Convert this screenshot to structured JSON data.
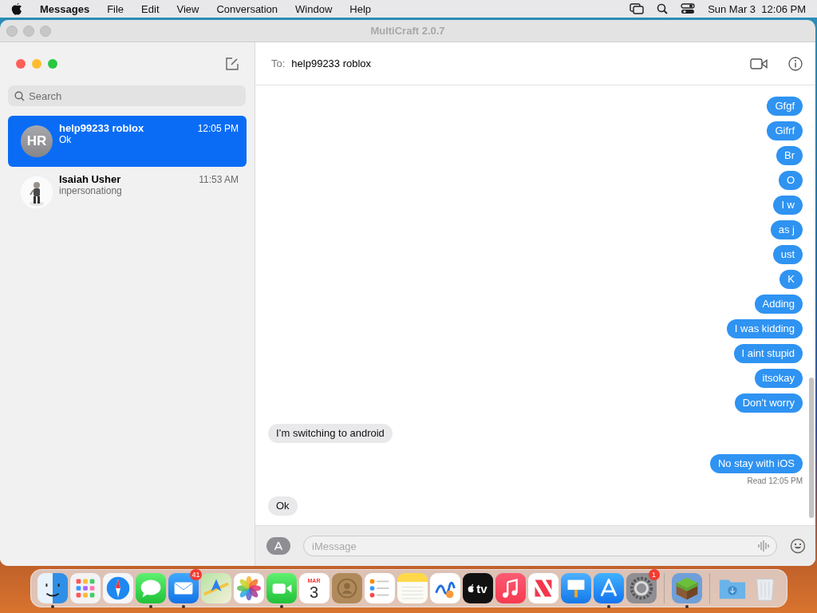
{
  "menu_bar": {
    "app": "Messages",
    "items": [
      "File",
      "Edit",
      "View",
      "Conversation",
      "Window",
      "Help"
    ],
    "date": "Sun Mar 3",
    "time": "12:06 PM"
  },
  "background_window": {
    "title": "MultiCraft 2.0.7"
  },
  "sidebar": {
    "search": {
      "placeholder": "Search"
    },
    "conversations": [
      {
        "name": "help99233 roblox",
        "preview": "Ok",
        "time": "12:05 PM",
        "avatar": {
          "kind": "initials",
          "text": "HR"
        },
        "selected": true
      },
      {
        "name": "Isaiah Usher",
        "preview": "inpersonationg",
        "time": "11:53 AM",
        "selected": false
      }
    ]
  },
  "conversation": {
    "to_label": "To:",
    "recipient": "help99233 roblox",
    "messages": [
      {
        "kind": "outgoing",
        "text": "Gfgf"
      },
      {
        "kind": "outgoing",
        "text": "Gifrf"
      },
      {
        "kind": "outgoing",
        "text": "Br"
      },
      {
        "kind": "outgoing",
        "text": "O"
      },
      {
        "kind": "outgoing",
        "text": "I w"
      },
      {
        "kind": "outgoing",
        "text": "as j"
      },
      {
        "kind": "outgoing",
        "text": "ust"
      },
      {
        "kind": "outgoing",
        "text": "K"
      },
      {
        "kind": "outgoing",
        "text": "Adding"
      },
      {
        "kind": "outgoing",
        "text": "I was kidding"
      },
      {
        "kind": "outgoing",
        "text": "I aint stupid"
      },
      {
        "kind": "outgoing",
        "text": "itsokay"
      },
      {
        "kind": "outgoing",
        "text": "Don't worry"
      },
      {
        "kind": "incoming",
        "text": "I’m switching to android"
      },
      {
        "kind": "outgoing",
        "text": "No stay with iOS",
        "receipt": "Read 12:05 PM"
      },
      {
        "kind": "incoming",
        "text": "Ok"
      }
    ],
    "composer": {
      "placeholder": "iMessage"
    }
  },
  "dock": [
    {
      "kind": "finder",
      "running": true
    },
    {
      "kind": "launchpad",
      "running": false
    },
    {
      "kind": "safari",
      "running": false
    },
    {
      "kind": "messages",
      "running": true
    },
    {
      "kind": "mail",
      "running": true,
      "badge": "41"
    },
    {
      "kind": "maps",
      "running": false
    },
    {
      "kind": "photos",
      "running": false
    },
    {
      "kind": "facetime",
      "running": true
    },
    {
      "kind": "calendar",
      "running": false,
      "month": "MAR",
      "day": "3"
    },
    {
      "kind": "contacts",
      "running": false
    },
    {
      "kind": "reminders",
      "running": false
    },
    {
      "kind": "notes",
      "running": false
    },
    {
      "kind": "freeform",
      "running": false
    },
    {
      "kind": "tv",
      "running": false,
      "label": "tv"
    },
    {
      "kind": "music",
      "running": false
    },
    {
      "kind": "news",
      "running": false
    },
    {
      "kind": "keynote",
      "running": false
    },
    {
      "kind": "appstore",
      "running": true
    },
    {
      "kind": "settings",
      "running": false,
      "badge": "1"
    },
    {
      "kind": "separator"
    },
    {
      "kind": "minecraft",
      "running": true
    },
    {
      "kind": "separator"
    },
    {
      "kind": "downloads",
      "running": false
    },
    {
      "kind": "trash",
      "running": false
    }
  ]
}
